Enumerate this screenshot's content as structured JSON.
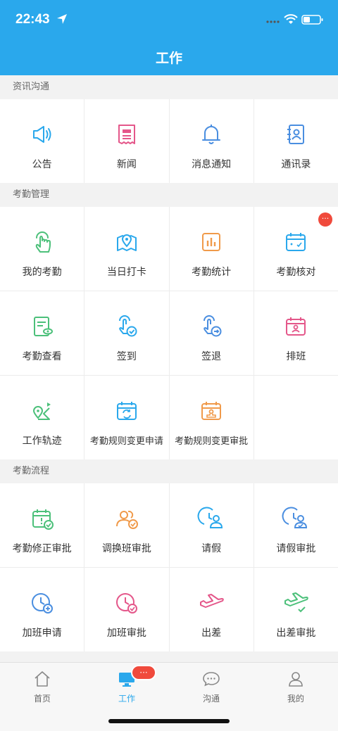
{
  "status_bar": {
    "time": "22:43"
  },
  "header": {
    "title": "工作"
  },
  "sections": [
    {
      "title": "资讯沟通",
      "items": [
        {
          "label": "公告",
          "icon": "megaphone-icon"
        },
        {
          "label": "新闻",
          "icon": "newspaper-icon"
        },
        {
          "label": "消息通知",
          "icon": "bell-icon"
        },
        {
          "label": "通讯录",
          "icon": "contacts-book-icon"
        }
      ]
    },
    {
      "title": "考勤管理",
      "items": [
        {
          "label": "我的考勤",
          "icon": "finger-tap-icon"
        },
        {
          "label": "当日打卡",
          "icon": "map-pin-icon"
        },
        {
          "label": "考勤统计",
          "icon": "bar-stats-icon"
        },
        {
          "label": "考勤核对",
          "icon": "calendar-check-icon",
          "badge": "···"
        },
        {
          "label": "考勤查看",
          "icon": "document-view-icon"
        },
        {
          "label": "签到",
          "icon": "sign-in-icon"
        },
        {
          "label": "签退",
          "icon": "sign-out-icon"
        },
        {
          "label": "排班",
          "icon": "calendar-person-icon"
        },
        {
          "label": "工作轨迹",
          "icon": "route-icon"
        },
        {
          "label": "考勤规则变更申请",
          "icon": "calendar-refresh-icon"
        },
        {
          "label": "考勤规则变更审批",
          "icon": "calendar-stamp-icon"
        }
      ]
    },
    {
      "title": "考勤流程",
      "items": [
        {
          "label": "考勤修正审批",
          "icon": "calendar-alert-icon"
        },
        {
          "label": "调换班审批",
          "icon": "people-swap-icon"
        },
        {
          "label": "请假",
          "icon": "clock-person-icon"
        },
        {
          "label": "请假审批",
          "icon": "clock-person-approve-icon"
        },
        {
          "label": "加班申请",
          "icon": "clock-plus-icon"
        },
        {
          "label": "加班审批",
          "icon": "clock-check-icon"
        },
        {
          "label": "出差",
          "icon": "airplane-icon"
        },
        {
          "label": "出差审批",
          "icon": "airplane-check-icon"
        }
      ]
    }
  ],
  "tabbar": {
    "items": [
      {
        "label": "首页",
        "icon": "home-icon"
      },
      {
        "label": "工作",
        "icon": "work-monitor-icon",
        "active": true
      },
      {
        "label": "沟通",
        "icon": "chat-bubble-icon"
      },
      {
        "label": "我的",
        "icon": "person-icon"
      }
    ],
    "work_badge": "···"
  },
  "colors": {
    "primary": "#2aa8ec",
    "badge": "#f04a3c"
  }
}
